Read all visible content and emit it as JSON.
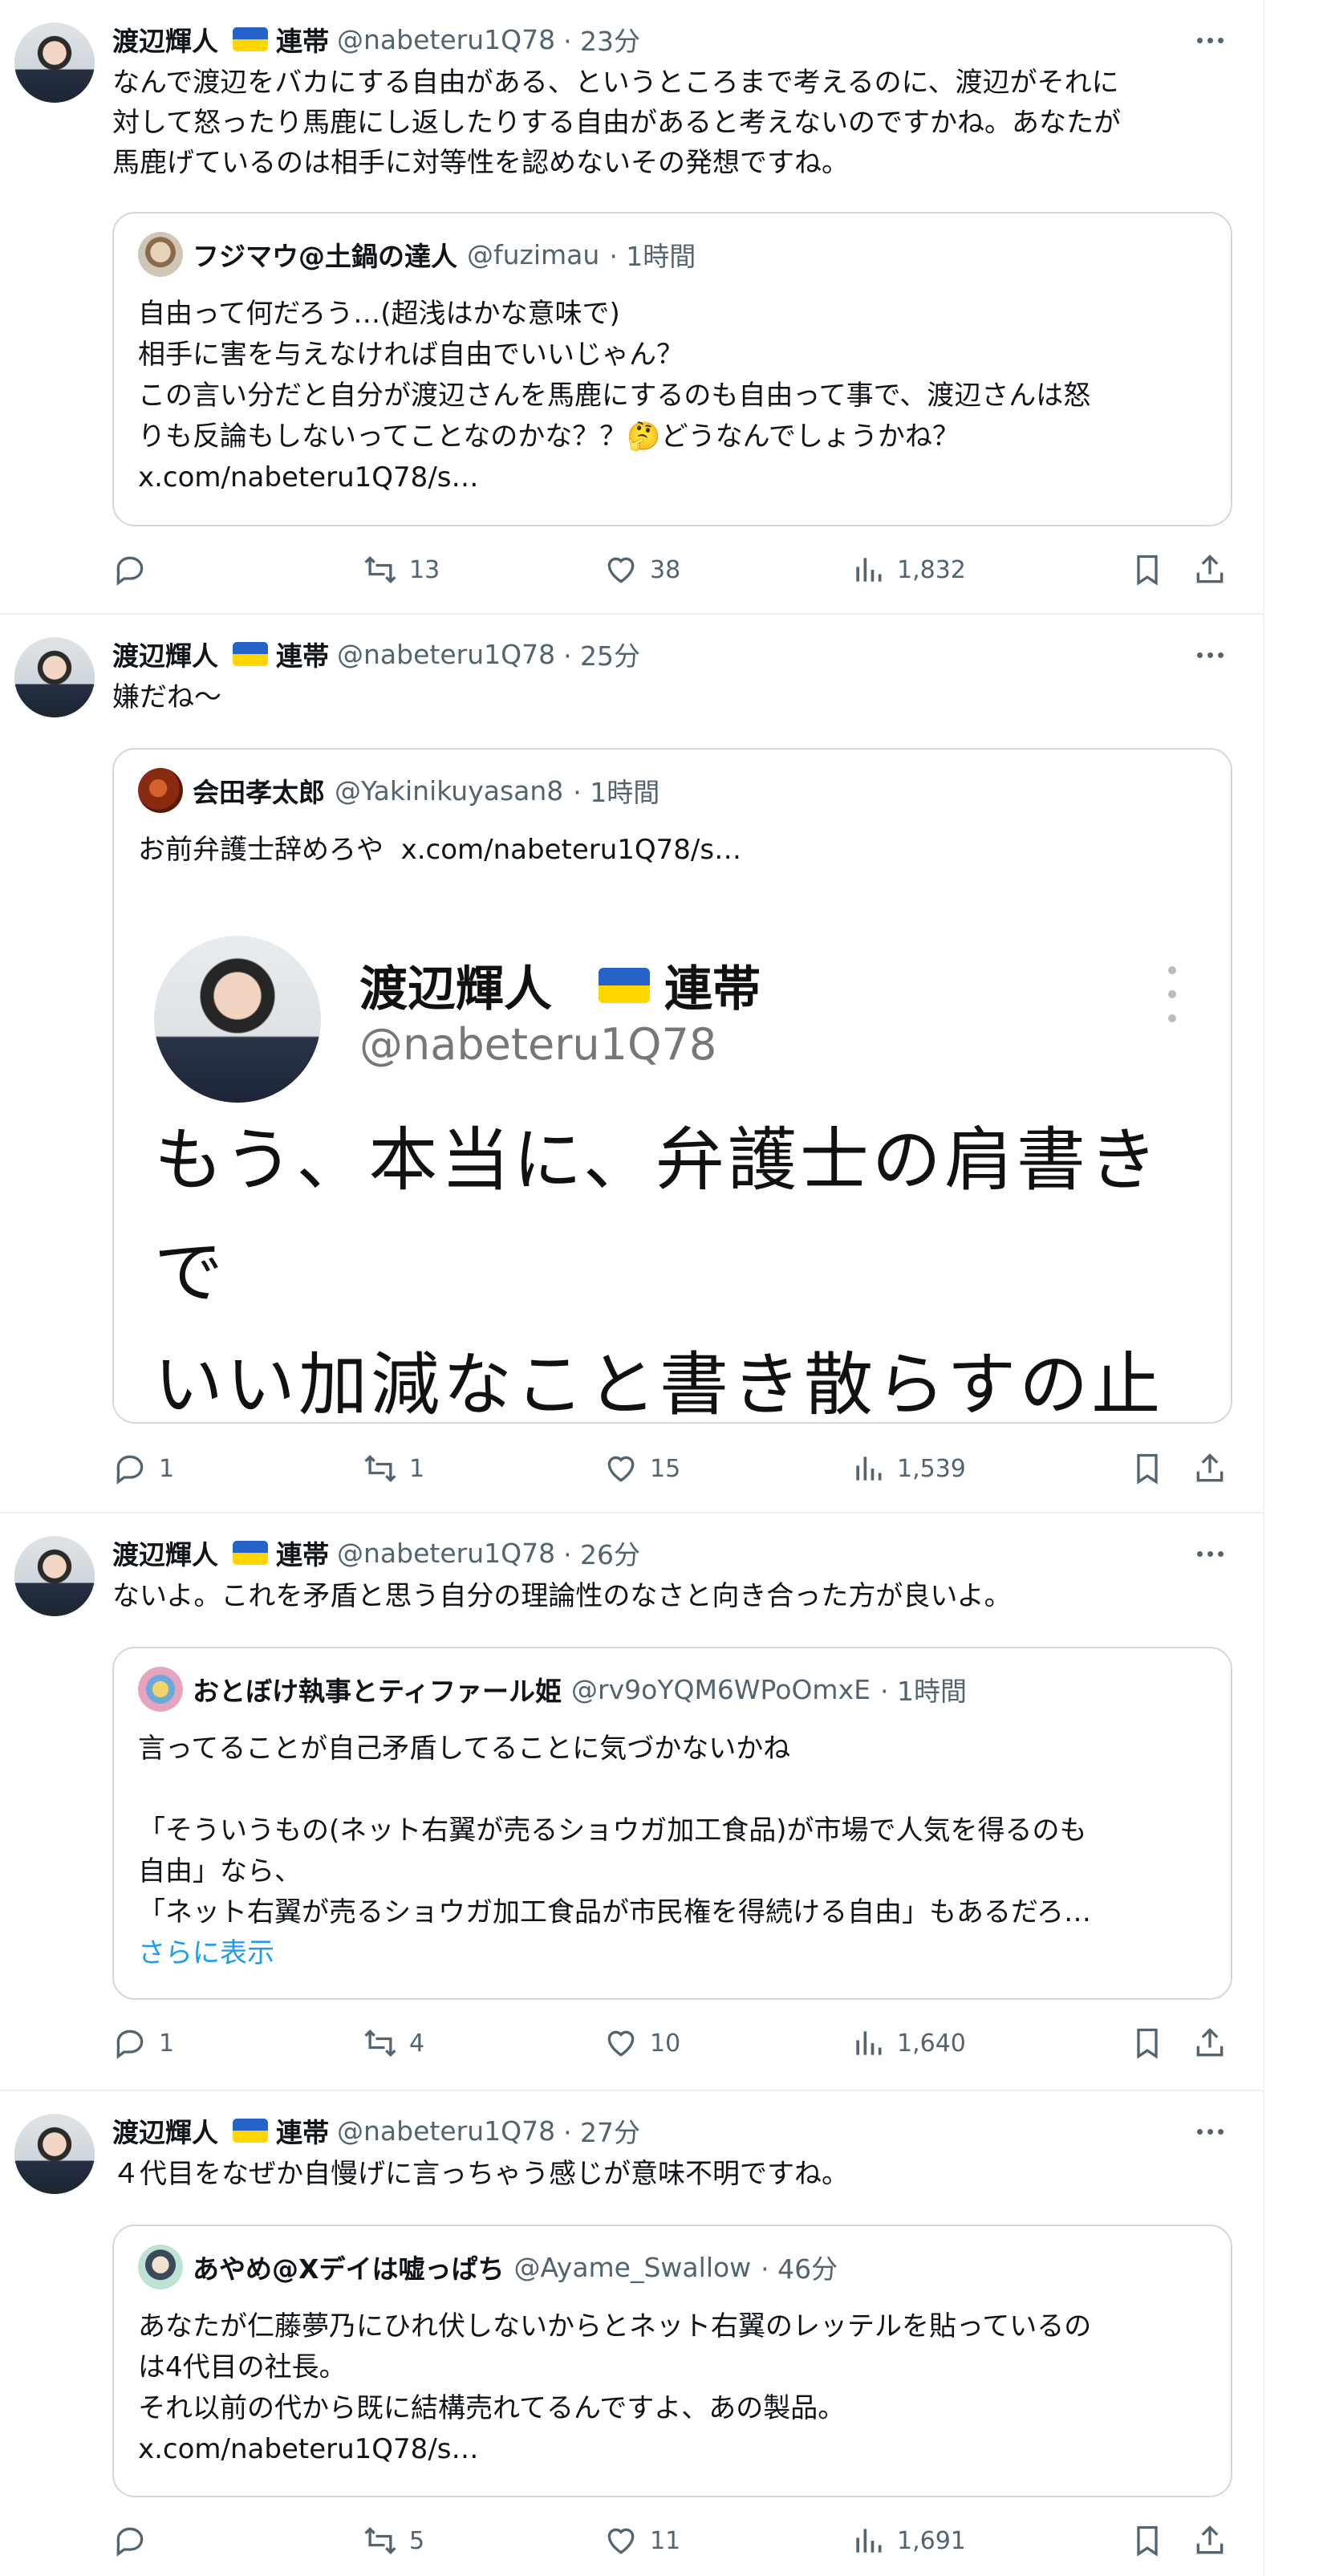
{
  "tweets": [
    {
      "author": "渡辺輝人",
      "badge": "連帯",
      "handle": "@nabeteru1Q78",
      "time": "· 23分",
      "text": "なんで渡辺をバカにする自由がある、というところまで考えるのに、渡辺がそれに\n対して怒ったり馬鹿にし返したりする自由があると考えないのですかね。あなたが\n馬鹿げているのは相手に対等性を認めないその発想ですね。",
      "quote": {
        "author": "フジマウ@土鍋の達人",
        "handle": "@fuzimau",
        "time": "· 1時間",
        "text": "自由って何だろう…(超浅はかな意味で)\n相手に害を与えなければ自由でいいじゃん？\nこの言い分だと自分が渡辺さんを馬鹿にするのも自由って事で、渡辺さんは怒\nりも反論もしないってことなのかな？？🤔どうなんでしょうかね？\nx.com/nabeteru1Q78/s…"
      },
      "replies": "",
      "retweets": "13",
      "likes": "38",
      "views": "1,832"
    },
    {
      "author": "渡辺輝人",
      "badge": "連帯",
      "handle": "@nabeteru1Q78",
      "time": "· 25分",
      "text": "嫌だね～",
      "quote": {
        "author": "会田孝太郎",
        "handle": "@Yakinikuyasan8",
        "time": "· 1時間",
        "text": "お前弁護士辞めろや  x.com/nabeteru1Q78/s…",
        "image": {
          "name": "渡辺輝人",
          "badge": "連帯",
          "handle": "@nabeteru1Q78",
          "body": "もう、本当に、弁護士の肩書きで\nいい加減なこと書き散らすの止め\nなさいよ。"
        }
      },
      "replies": "1",
      "retweets": "1",
      "likes": "15",
      "views": "1,539"
    },
    {
      "author": "渡辺輝人",
      "badge": "連帯",
      "handle": "@nabeteru1Q78",
      "time": "· 26分",
      "text": "ないよ。これを矛盾と思う自分の理論性のなさと向き合った方が良いよ。",
      "quote": {
        "author": "おとぼけ執事とティファール姫",
        "handle": "@rv9oYQM6WPoOmxE",
        "time": "· 1時間",
        "text": "言ってることが自己矛盾してることに気づかないかね\n\n「そういうもの(ネット右翼が売るショウガ加工食品)が市場で人気を得るのも\n自由」なら、\n「ネット右翼が売るショウガ加工食品が市民権を得続ける自由」もあるだろ…",
        "show_more": "さらに表示"
      },
      "replies": "1",
      "retweets": "4",
      "likes": "10",
      "views": "1,640"
    },
    {
      "author": "渡辺輝人",
      "badge": "連帯",
      "handle": "@nabeteru1Q78",
      "time": "· 27分",
      "text": "４代目をなぜか自慢げに言っちゃう感じが意味不明ですね。",
      "quote": {
        "author": "あやめ@Xデイは嘘っぱち",
        "handle": "@Ayame_Swallow",
        "time": "· 46分",
        "text": "あなたが仁藤夢乃にひれ伏しないからとネット右翼のレッテルを貼っているの\nは4代目の社長。\nそれ以前の代から既に結構売れてるんですよ、あの製品。\nx.com/nabeteru1Q78/s…"
      },
      "replies": "",
      "retweets": "5",
      "likes": "11",
      "views": "1,691"
    }
  ],
  "icons": [
    "reply-icon",
    "retweet-icon",
    "like-icon",
    "views-icon",
    "bookmark-icon",
    "share-icon",
    "more-icon",
    "ukraine-flag-icon"
  ],
  "colors": {
    "text": "#0f1419",
    "muted": "#536471",
    "link": "#1d9bf0",
    "border": "#cfd9de"
  }
}
